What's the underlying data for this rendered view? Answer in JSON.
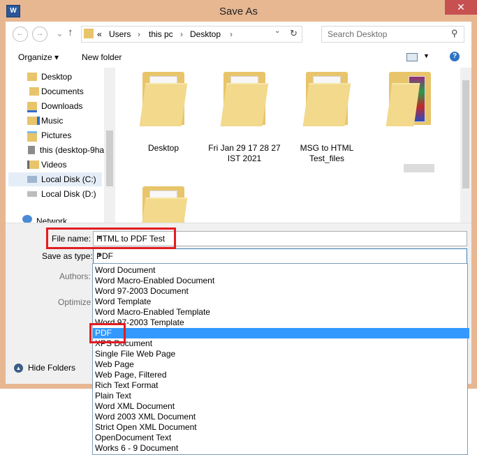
{
  "window": {
    "title": "Save As",
    "close_label": "✕",
    "app_icon_label": "W"
  },
  "nav": {
    "back_glyph": "←",
    "forward_glyph": "→",
    "up_glyph": "↑",
    "breadcrumb_prefix": "«",
    "breadcrumb": [
      "Users",
      "this pc",
      "Desktop"
    ],
    "separator": "›",
    "search_placeholder": "Search Desktop"
  },
  "toolbar": {
    "organize_label": "Organize ▾",
    "new_folder_label": "New folder"
  },
  "sidebar": {
    "items": [
      {
        "label": "Desktop",
        "icon": "folder-icon"
      },
      {
        "label": "Documents",
        "icon": "documents-icon"
      },
      {
        "label": "Downloads",
        "icon": "downloads-icon"
      },
      {
        "label": "Music",
        "icon": "music-icon"
      },
      {
        "label": "Pictures",
        "icon": "pictures-icon"
      },
      {
        "label": "this (desktop-9ha",
        "icon": "computer-icon"
      },
      {
        "label": "Videos",
        "icon": "videos-icon"
      },
      {
        "label": "Local Disk (C:)",
        "icon": "drive-icon"
      },
      {
        "label": "Local Disk (D:)",
        "icon": "drive-icon"
      },
      {
        "label": "Network",
        "icon": "network-icon"
      }
    ]
  },
  "folders": [
    {
      "label": "Desktop"
    },
    {
      "label": "Fri Jan 29 17 28 27 IST 2021"
    },
    {
      "label": "MSG to HTML Test_files"
    },
    {
      "label": ""
    },
    {
      "label": ""
    }
  ],
  "form": {
    "file_name_label": "File name:",
    "file_name_value": "HTML to PDF Test",
    "save_type_label": "Save as type:",
    "save_type_value": "PDF",
    "authors_label": "Authors:",
    "optimize_label": "Optimize",
    "hide_folders_label": "Hide Folders"
  },
  "dropdown_options": [
    "Word Document",
    "Word Macro-Enabled Document",
    "Word 97-2003 Document",
    "Word Template",
    "Word Macro-Enabled Template",
    "Word 97-2003 Template",
    "PDF",
    "XPS Document",
    "Single File Web Page",
    "Web Page",
    "Web Page, Filtered",
    "Rich Text Format",
    "Plain Text",
    "Word XML Document",
    "Word 2003 XML Document",
    "Strict Open XML Document",
    "OpenDocument Text",
    "Works 6 - 9 Document"
  ],
  "selected_option": "PDF",
  "colors": {
    "highlight": "#e21c22",
    "selection": "#3399ff",
    "title_bar": "#e7b792"
  }
}
